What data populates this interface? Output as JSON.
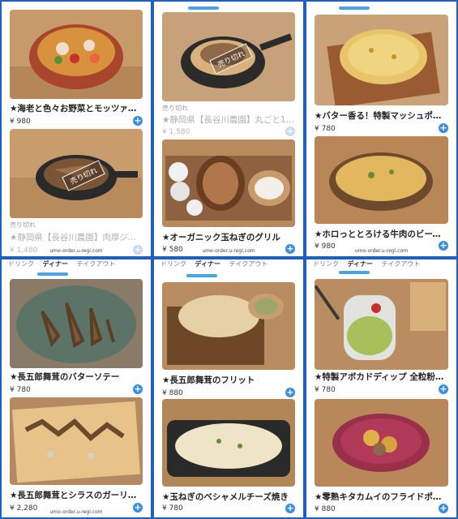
{
  "tabs": {
    "drink": "ドリンク",
    "dinner": "ディナー",
    "takeout": "テイクアウト"
  },
  "footer_url": "umo-order.u-regi.com",
  "soldout_text": "売り切れ",
  "plus_glyph": "+",
  "colors": {
    "accent": "#3a8ee0",
    "border": "#1f5fbf"
  },
  "panels": [
    {
      "items": [
        {
          "name": "★海老と色々お野菜とモッツァレ…",
          "price": "¥ 980",
          "sold_out": false
        },
        {
          "name": "★静岡県【長谷川農園】肉厚ジュ…",
          "price": "¥ 1,480",
          "sold_out": true
        }
      ]
    },
    {
      "items": [
        {
          "name": "★静岡県【長谷川農園】丸ごと1…",
          "price": "¥ 1,580",
          "sold_out": true
        },
        {
          "name": "★オーガニック玉ねぎのグリル",
          "price": "¥ 580",
          "sold_out": false
        }
      ]
    },
    {
      "items": [
        {
          "name": "★バター香る！特製マッシュポテ…",
          "price": "¥ 780",
          "sold_out": false
        },
        {
          "name": "★ホロっととろける牛肉のビーフ…",
          "price": "¥ 980",
          "sold_out": false
        }
      ]
    },
    {
      "items": [
        {
          "name": "★長五郎舞茸のバターソテー",
          "price": "¥ 780",
          "sold_out": false
        },
        {
          "name": "★長五郎舞茸とシラスのガーリッ…",
          "price": "¥ 2,280",
          "sold_out": false
        }
      ]
    },
    {
      "items": [
        {
          "name": "★長五郎舞茸のフリット",
          "price": "¥ 880",
          "sold_out": false
        },
        {
          "name": "★玉ねぎのベシャメルチーズ焼き",
          "price": "¥ 780",
          "sold_out": false
        }
      ]
    },
    {
      "items": [
        {
          "name": "★特製アボカドディップ 全粒粉ク…",
          "price": "¥ 780",
          "sold_out": false
        },
        {
          "name": "★零熟キタカムイのフライドポテト",
          "price": "¥ 880",
          "sold_out": false
        }
      ]
    }
  ]
}
